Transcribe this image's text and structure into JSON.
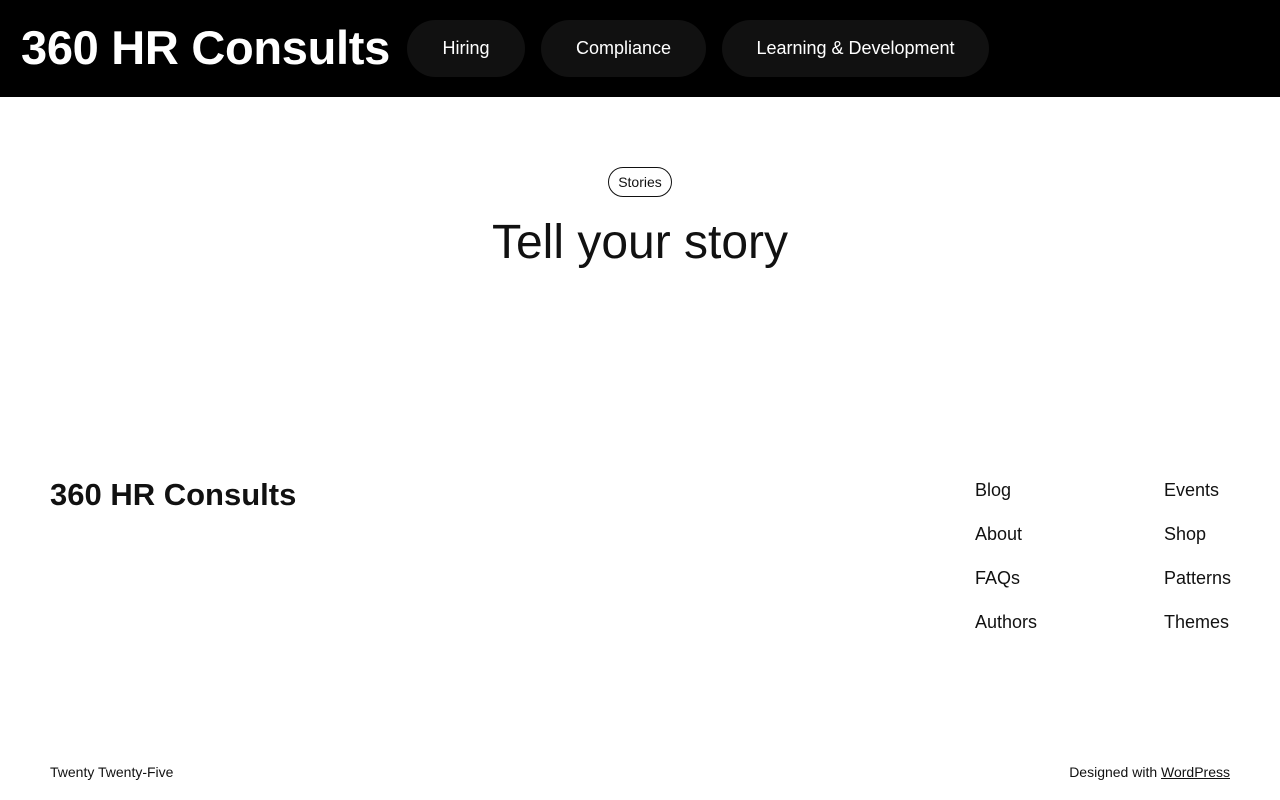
{
  "header": {
    "site_title": "360 HR Consults",
    "nav": [
      {
        "label": "Hiring"
      },
      {
        "label": "Compliance"
      },
      {
        "label": "Learning & Development"
      }
    ]
  },
  "main": {
    "category_badge": "Stories",
    "heading": "Tell your story"
  },
  "footer": {
    "site_title": "360 HR Consults",
    "links_col1": [
      "Blog",
      "About",
      "FAQs",
      "Authors"
    ],
    "links_col2": [
      "Events",
      "Shop",
      "Patterns",
      "Themes"
    ],
    "theme_credit": "Twenty Twenty-Five",
    "designed_with_prefix": "Designed with",
    "designed_with_link": "WordPress"
  },
  "colors": {
    "header_bg": "#000000",
    "nav_pill_bg": "#111111",
    "text": "#111111",
    "page_bg": "#ffffff"
  }
}
